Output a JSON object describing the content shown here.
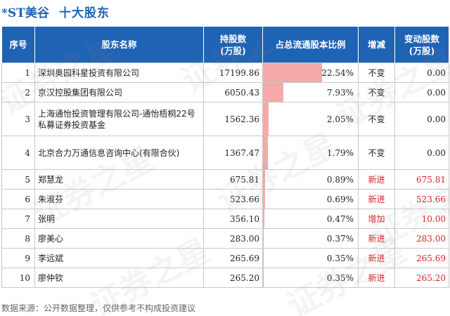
{
  "title": {
    "stock": "*ST美谷",
    "label": "十大股东"
  },
  "headers": {
    "rank": "序号",
    "name": "股东名称",
    "shares": "持股数\n(万股)",
    "ratio": "占总流通股本比例",
    "change": "增减",
    "delta": "变动股数\n(万股)"
  },
  "rows": [
    {
      "rank": "1",
      "name": "深圳奥园科星投资有限公司",
      "shares": "17199.86",
      "ratio": "22.54%",
      "ratio_value": 22.54,
      "change": "不变",
      "delta": "0.00",
      "highlight": false
    },
    {
      "rank": "2",
      "name": "京汉控股集团有限公司",
      "shares": "6050.43",
      "ratio": "7.93%",
      "ratio_value": 7.93,
      "change": "不变",
      "delta": "0.00",
      "highlight": false
    },
    {
      "rank": "3",
      "name": "上海通怡投资管理有限公司-通怡梧桐22号私募证券投资基金",
      "shares": "1562.36",
      "ratio": "2.05%",
      "ratio_value": 2.05,
      "change": "不变",
      "delta": "0.00",
      "highlight": false
    },
    {
      "rank": "4",
      "name": "北京合力万通信息咨询中心(有限合伙)",
      "shares": "1367.47",
      "ratio": "1.79%",
      "ratio_value": 1.79,
      "change": "不变",
      "delta": "0.00",
      "highlight": false
    },
    {
      "rank": "5",
      "name": "郑慧龙",
      "shares": "675.81",
      "ratio": "0.89%",
      "ratio_value": 0.89,
      "change": "新进",
      "delta": "675.81",
      "highlight": true
    },
    {
      "rank": "6",
      "name": "朱淑芬",
      "shares": "523.66",
      "ratio": "0.69%",
      "ratio_value": 0.69,
      "change": "新进",
      "delta": "523.66",
      "highlight": true
    },
    {
      "rank": "7",
      "name": "张明",
      "shares": "356.10",
      "ratio": "0.47%",
      "ratio_value": 0.47,
      "change": "增加",
      "delta": "10.00",
      "highlight": true
    },
    {
      "rank": "8",
      "name": "廖美心",
      "shares": "283.00",
      "ratio": "0.37%",
      "ratio_value": 0.37,
      "change": "新进",
      "delta": "283.00",
      "highlight": true
    },
    {
      "rank": "9",
      "name": "李远斌",
      "shares": "265.69",
      "ratio": "0.35%",
      "ratio_value": 0.35,
      "change": "新进",
      "delta": "265.69",
      "highlight": true
    },
    {
      "rank": "10",
      "name": "廖仲钦",
      "shares": "265.20",
      "ratio": "0.35%",
      "ratio_value": 0.35,
      "change": "新进",
      "delta": "265.20",
      "highlight": true
    }
  ],
  "footer": "数据来源：公开数据整理，仅供参考不构成投资建议",
  "watermark": "证券之星",
  "colors": {
    "header_bg": "#1f63b4",
    "bar": "#f5a9a9",
    "highlight": "#d6252a"
  }
}
